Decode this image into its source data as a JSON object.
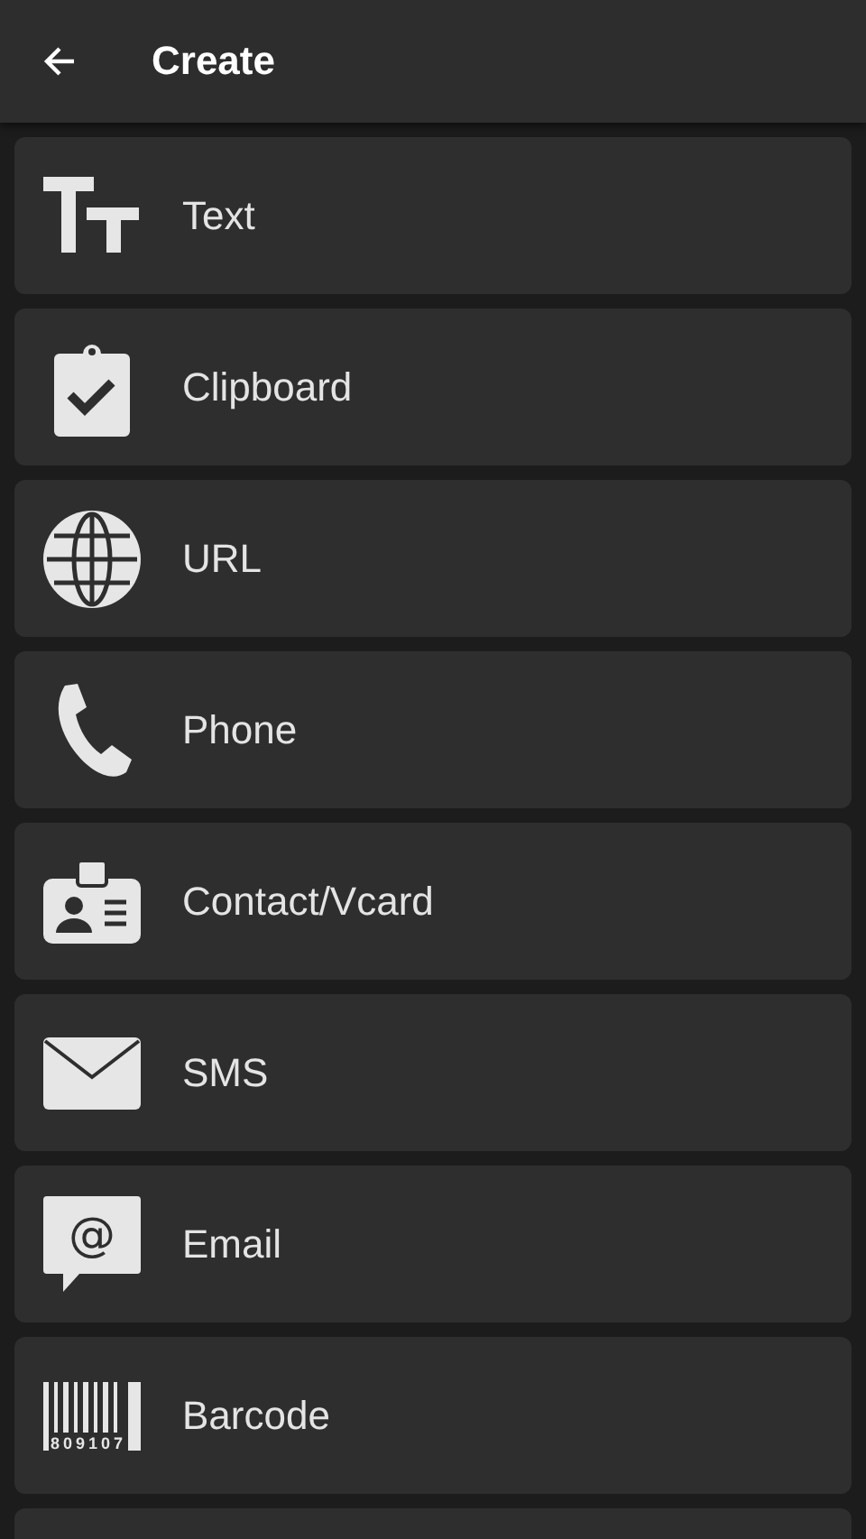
{
  "app_bar": {
    "title": "Create"
  },
  "items": [
    {
      "kind": "text",
      "label": "Text"
    },
    {
      "kind": "clipboard",
      "label": "Clipboard"
    },
    {
      "kind": "globe",
      "label": "URL"
    },
    {
      "kind": "phone",
      "label": "Phone"
    },
    {
      "kind": "contact",
      "label": "Contact/Vcard"
    },
    {
      "kind": "envelope",
      "label": "SMS"
    },
    {
      "kind": "chat",
      "label": "Email",
      "icon_glyph": "@"
    },
    {
      "kind": "barcode",
      "label": "Barcode",
      "icon_caption": "809107"
    }
  ]
}
